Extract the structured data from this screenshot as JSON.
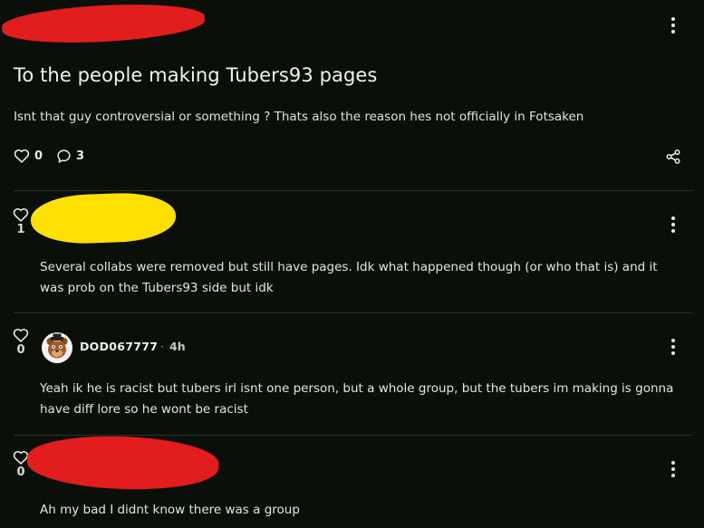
{
  "post": {
    "title": "To the people making Tubers93 pages",
    "body": "Isnt that guy controversial or something ? Thats also the reason hes not officially in Fotsaken",
    "likes": "0",
    "comments": "3"
  },
  "comments": [
    {
      "likes": "1",
      "text": "Several collabs were removed but still have pages. Idk what happened though (or who that is) and it was prob on the Tubers93 side but idk"
    },
    {
      "likes": "0",
      "author": "DOD067777",
      "separator": "·",
      "time": "4h",
      "text": "Yeah ik he is racist but tubers irl isnt one person, but a whole group, but the tubers im making is gonna have diff lore so he wont be racist"
    },
    {
      "likes": "0",
      "text": "Ah my bad I didnt know there was a group"
    }
  ],
  "icons": {
    "like": "heart-icon",
    "comment": "comment-icon",
    "share": "share-icon",
    "menu": "kebab-menu-icon"
  },
  "colors": {
    "background": "#0b0f0a",
    "redaction_red": "#e21d1d",
    "redaction_yellow": "#ffe000"
  }
}
